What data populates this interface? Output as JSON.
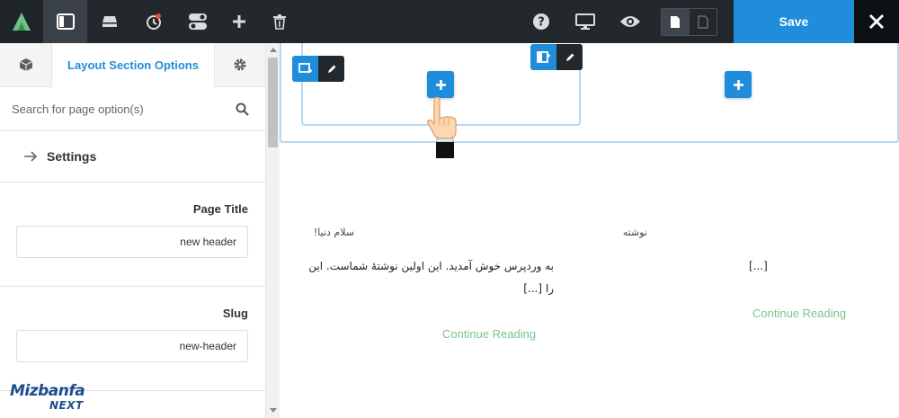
{
  "topbar": {
    "logo_icon": "brand-leaf-icon",
    "layout_icon": "layout-panel-icon",
    "icons": [
      "layout-panel-icon",
      "header-footer-icon",
      "history-icon",
      "toggle-switches-icon",
      "add-icon",
      "trash-icon",
      "help-icon",
      "desktop-preview-icon",
      "eye-preview-icon",
      "page-document-icon",
      "page-document-outline-icon",
      "close-icon"
    ],
    "save_label": "Save",
    "accent": "#1f8ddc"
  },
  "sidebar": {
    "active_tab_label": "Layout Section Options",
    "search_placeholder": "Search for page option(s)",
    "settings_label": "Settings",
    "fields": [
      {
        "label": "Page Title",
        "value": "new header"
      },
      {
        "label": "Slug",
        "value": "new-header"
      }
    ]
  },
  "watermark": {
    "line1": "Mizbanfa",
    "line2": "NEXT"
  },
  "canvas": {
    "posts": [
      {
        "title": "سلام دنیا!",
        "excerpt_line1": "به وردپرس خوش آمدید. این اولین نوشتهٔ شماست. این",
        "excerpt_line2": "را [...]",
        "continue_label": "Continue Reading"
      },
      {
        "title": "نوشته",
        "excerpt_line1": "[...]",
        "continue_label": "Continue Reading"
      }
    ],
    "link_color": "#7cc48c"
  }
}
